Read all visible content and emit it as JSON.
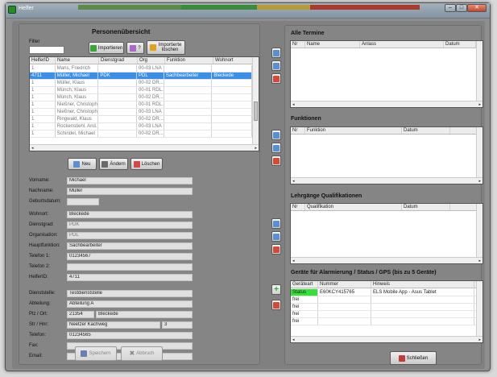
{
  "window": {
    "title": "Helfer"
  },
  "left": {
    "title": "Personenübersicht",
    "filter_label": "Filter",
    "filter_value": "",
    "buttons": {
      "import": "Importieren",
      "help": "?",
      "delete_imported": "Importierte löschen"
    },
    "columns": [
      "HelferID",
      "Name",
      "Dienstgrad",
      "Org",
      "Funktion",
      "Wohnort"
    ],
    "rows": [
      [
        "1",
        "Mans, Friedrich",
        "",
        "00-03 LNA",
        "",
        ""
      ],
      [
        "4711",
        "Müller, Michael",
        "PDK",
        "PDL",
        "Sachbearbeiter",
        "Bleckede"
      ],
      [
        "1",
        "Müller, Klaus",
        "",
        "00-02 DR...",
        "",
        ""
      ],
      [
        "1",
        "Münch, Klaus",
        "",
        "00-01 RDL...",
        "",
        ""
      ],
      [
        "1",
        "Münch, Klaus",
        "",
        "00-02 DR...",
        "",
        ""
      ],
      [
        "1",
        "Nießner, Christoph",
        "",
        "00-01 RDL...",
        "",
        ""
      ],
      [
        "1",
        "Nießner, Christoph",
        "",
        "00-03 LNA",
        "",
        ""
      ],
      [
        "1",
        "Ringwald, Klaus",
        "",
        "00-02 DR...",
        "",
        ""
      ],
      [
        "1",
        "Rockenstiehl, And...",
        "",
        "00-03 LNA",
        "",
        ""
      ],
      [
        "1",
        "Schindel, Michael",
        "",
        "00-02 DR...",
        "",
        ""
      ]
    ],
    "actions": {
      "new": "Neu",
      "edit": "Ändern",
      "delete": "Löschen"
    },
    "form": {
      "vorname": {
        "label": "Vorname:",
        "value": "Michael"
      },
      "nachname": {
        "label": "Nachname:",
        "value": "Müller"
      },
      "geburtsdatum": {
        "label": "Geburtsdatum:",
        "value": ""
      },
      "wohnort": {
        "label": "Wohnort:",
        "value": "Bleckede"
      },
      "dienstgrad": {
        "label": "Dienstgrad:",
        "value": "PDK"
      },
      "organisation": {
        "label": "Organisation:",
        "value": "PDL"
      },
      "hauptfunktion": {
        "label": "Hauptfunktion:",
        "value": "Sachbearbeiter"
      },
      "telefon1": {
        "label": "Telefon 1:",
        "value": "01234567"
      },
      "telefon2": {
        "label": "Telefon 2:",
        "value": ""
      },
      "helferid": {
        "label": "HelferID:",
        "value": "4711"
      },
      "dienststelle": {
        "label": "Dienststelle:",
        "value": "Testdienststelle"
      },
      "abteilung": {
        "label": "Abteilung:",
        "value": "Abteilung A"
      },
      "plz_ort": {
        "label": "Plz / Ort:",
        "plz": "21354",
        "ort": "Bleckede"
      },
      "str_hnr": {
        "label": "Str / Hnr:",
        "str": "Neetzer Kachweg",
        "hnr": "3"
      },
      "telefon": {
        "label": "Telefon:",
        "value": "01234565"
      },
      "fax": {
        "label": "Fax:",
        "value": ""
      },
      "email": {
        "label": "Email:",
        "value": ""
      }
    },
    "save": "Speichern",
    "cancel": "Abbruch"
  },
  "right": {
    "termine": {
      "title": "Alle Termine",
      "columns": [
        "Nr",
        "Name",
        "Anlass",
        "Datum"
      ]
    },
    "funktionen": {
      "title": "Funktionen",
      "columns": [
        "Nr",
        "Funktion",
        "Datum"
      ]
    },
    "lehrgaenge": {
      "title": "Lehrgänge Qualifikationen",
      "columns": [
        "Nr",
        "Qualifikation",
        "Datum"
      ]
    },
    "geraete": {
      "title": "Geräte für Alarmierung / Status / GPS  (bis zu 5 Geräte)",
      "columns": [
        "Geräteart",
        "Nummer",
        "Hinweis"
      ],
      "rows": [
        [
          "Status",
          "E60KCY415765",
          "ELS Mobile App - Asus Tablet"
        ],
        [
          "frei",
          "",
          ""
        ],
        [
          "frei",
          "",
          ""
        ],
        [
          "frei",
          "",
          ""
        ],
        [
          "frei",
          "",
          ""
        ]
      ]
    },
    "close": "Schließen"
  },
  "colors": {
    "selection": "#3b8fe6",
    "status_green": "#33e233",
    "panel": "#858585"
  }
}
